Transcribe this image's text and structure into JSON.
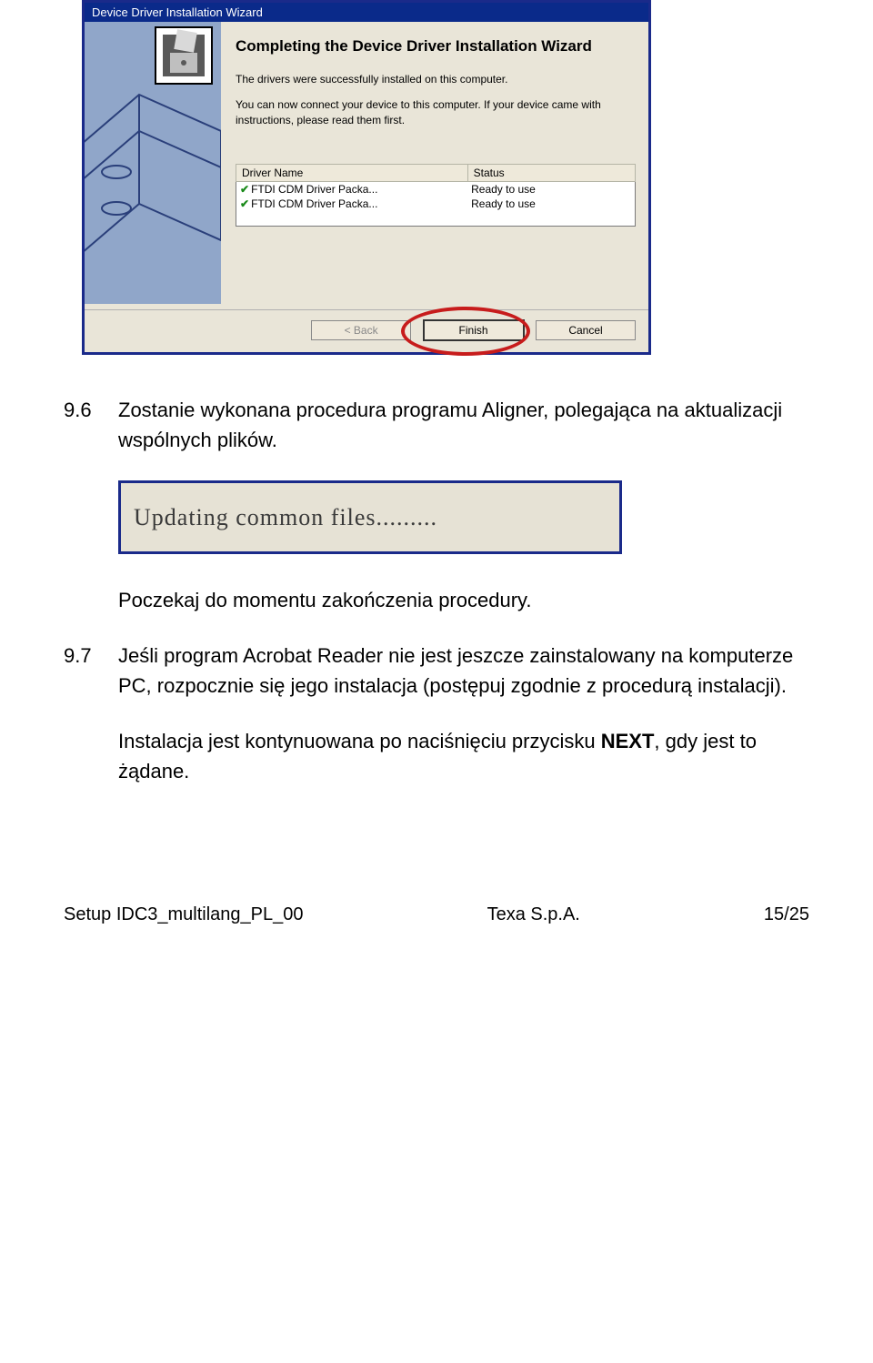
{
  "wizard": {
    "title": "Device Driver Installation Wizard",
    "heading": "Completing the Device Driver Installation Wizard",
    "line1": "The drivers were successfully installed on this computer.",
    "line2": "You can now connect your device to this computer. If your device came with instructions, please read them first.",
    "columns": {
      "name": "Driver Name",
      "status": "Status"
    },
    "rows": [
      {
        "name": "FTDI CDM Driver Packa...",
        "status": "Ready to use"
      },
      {
        "name": "FTDI CDM Driver Packa...",
        "status": "Ready to use"
      }
    ],
    "buttons": {
      "back": "< Back",
      "finish": "Finish",
      "cancel": "Cancel"
    }
  },
  "doc": {
    "s96_num": "9.6",
    "s96_text": "Zostanie wykonana procedura programu Aligner, polegająca na aktualizacji wspólnych plików.",
    "updating": "Updating common files.........",
    "wait_text": "Poczekaj do momentu zakończenia procedury.",
    "s97_num": "9.7",
    "s97_text": "Jeśli program Acrobat Reader nie jest jeszcze zainstalowany na komputerze PC, rozpocznie się jego instalacja (postępuj zgodnie z procedurą instalacji).",
    "cont_pre": "Instalacja jest kontynuowana po naciśnięciu przycisku ",
    "cont_bold": "NEXT",
    "cont_post": ", gdy jest to żądane."
  },
  "footer": {
    "left": "Setup IDC3_multilang_PL_00",
    "mid": "Texa S.p.A.",
    "right": "15/25"
  }
}
